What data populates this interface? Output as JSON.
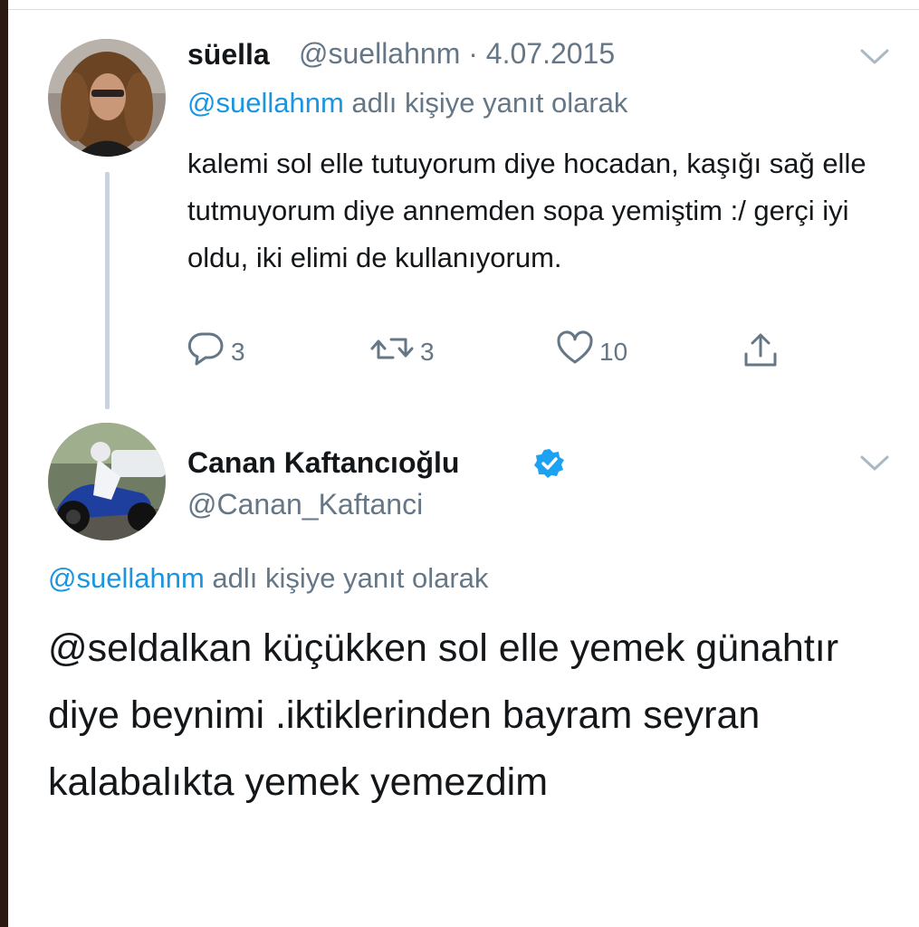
{
  "tweet1": {
    "display_name": "süella",
    "handle": "@suellahnm",
    "separator": "·",
    "date": "4.07.2015",
    "reply_to_handle": "@suellahnm",
    "reply_to_suffix": "adlı kişiye yanıt olarak",
    "body": "kalemi sol elle tutuyorum diye hocadan, kaşığı sağ elle tutmuyorum diye annemden sopa yemiştim :/ gerçi iyi oldu, iki elimi de kullanıyorum.",
    "actions": {
      "reply_count": "3",
      "retweet_count": "3",
      "like_count": "10"
    }
  },
  "tweet2": {
    "display_name": "Canan Kaftancıoğlu",
    "handle": "@Canan_Kaftanci",
    "reply_to_handle": "@suellahnm",
    "reply_to_suffix": "adlı kişiye yanıt olarak",
    "body": "@seldalkan küçükken sol elle yemek günahtır diye beynimi .iktiklerinden bayram seyran kalabalıkta yemek yemezdim"
  },
  "icons": {
    "reply": "reply-icon",
    "retweet": "retweet-icon",
    "like": "heart-icon",
    "share": "share-icon",
    "verified": "verified-badge-icon",
    "menu": "chevron-down-icon"
  },
  "colors": {
    "link_blue": "#1b95e0",
    "secondary_grey": "#657786",
    "text": "#14171a",
    "thread_line": "#c9d3de"
  }
}
